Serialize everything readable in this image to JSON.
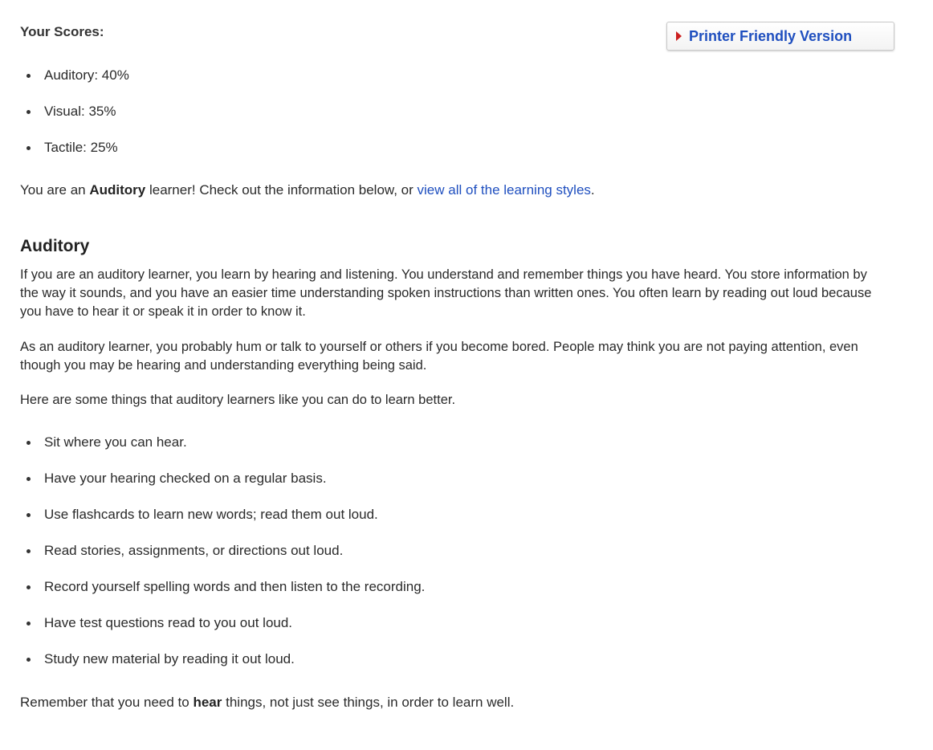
{
  "scores": {
    "title": "Your Scores:",
    "items": [
      {
        "label": "Auditory: 40%"
      },
      {
        "label": "Visual: 35%"
      },
      {
        "label": "Tactile: 25%"
      }
    ]
  },
  "printer_button": {
    "label": "Printer Friendly Version"
  },
  "result": {
    "prefix": "You are an ",
    "style": "Auditory",
    "middle": " learner! Check out the information below, or ",
    "link_text": "view all of the learning styles",
    "suffix": "."
  },
  "section": {
    "heading": "Auditory",
    "paragraph1": "If you are an auditory learner, you learn by hearing and listening. You understand and remember things you have heard. You store information by the way it sounds, and you have an easier time understanding spoken instructions than written ones. You often learn by reading out loud because you have to hear it or speak it in order to know it.",
    "paragraph2": "As an auditory learner, you probably hum or talk to yourself or others if you become bored. People may think you are not paying attention, even though you may be hearing and understanding everything being said.",
    "paragraph3": "Here are some things that auditory learners like you can do to learn better.",
    "tips": [
      "Sit where you can hear.",
      "Have your hearing checked on a regular basis.",
      "Use flashcards to learn new words; read them out loud.",
      "Read stories, assignments, or directions out loud.",
      "Record yourself spelling words and then listen to the recording.",
      "Have test questions read to you out loud.",
      "Study new material by reading it out loud."
    ],
    "closing": {
      "prefix": "Remember that you need to ",
      "bold": "hear",
      "suffix": " things, not just see things, in order to learn well."
    }
  },
  "colors": {
    "link": "#1f4fbf",
    "arrow": "#cc1f1f",
    "text": "#2a2a2a"
  },
  "icons": {
    "printer_button_arrow": "red-triangle-right-icon"
  }
}
